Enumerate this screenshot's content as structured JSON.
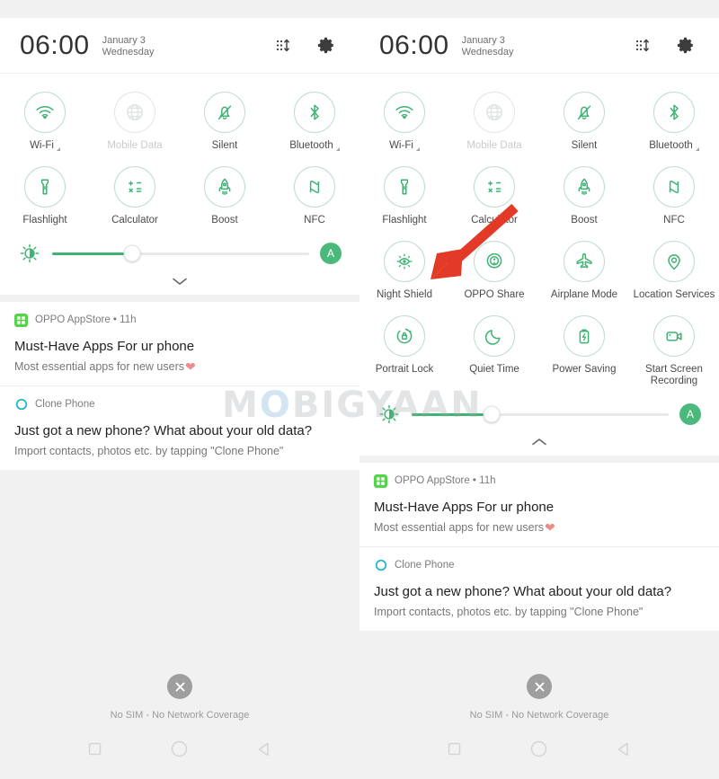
{
  "status": {
    "time": "06:00",
    "date": "January 3",
    "weekday": "Wednesday",
    "header_icons": {
      "edit_tiles": "edit-tiles-icon",
      "settings": "gear-icon"
    }
  },
  "brightness": {
    "sun_icon": "brightness-icon",
    "level_percent": 31,
    "auto_label": "A",
    "expand_icon": "chevron-down-icon",
    "collapse_icon": "chevron-up-icon"
  },
  "colors": {
    "accent_green": "#4cb97c",
    "tile_outline": "#bfdcce",
    "tile_outline_off": "#e2e6e3",
    "panel_bg": "#ffffff",
    "page_bg": "#f1f1f1",
    "arrow_red": "#e23a26",
    "label": "#4a4a4a",
    "label_off": "#c9cdca"
  },
  "tiles_collapsed": [
    {
      "label": "Wi-Fi",
      "icon": "wifi-icon",
      "enabled": true,
      "has_expand_arrow": true
    },
    {
      "label": "Mobile Data",
      "icon": "globe-icon",
      "enabled": false,
      "has_expand_arrow": false
    },
    {
      "label": "Silent",
      "icon": "bell-muted-icon",
      "enabled": true,
      "has_expand_arrow": false
    },
    {
      "label": "Bluetooth",
      "icon": "bluetooth-icon",
      "enabled": true,
      "has_expand_arrow": true
    },
    {
      "label": "Flashlight",
      "icon": "flashlight-icon",
      "enabled": true,
      "has_expand_arrow": false
    },
    {
      "label": "Calculator",
      "icon": "calculator-icon",
      "enabled": true,
      "has_expand_arrow": false
    },
    {
      "label": "Boost",
      "icon": "rocket-icon",
      "enabled": true,
      "has_expand_arrow": false
    },
    {
      "label": "NFC",
      "icon": "nfc-icon",
      "enabled": true,
      "has_expand_arrow": false
    }
  ],
  "tiles_expanded": [
    {
      "label": "Wi-Fi",
      "icon": "wifi-icon",
      "enabled": true,
      "has_expand_arrow": true
    },
    {
      "label": "Mobile Data",
      "icon": "globe-icon",
      "enabled": false,
      "has_expand_arrow": false
    },
    {
      "label": "Silent",
      "icon": "bell-muted-icon",
      "enabled": true,
      "has_expand_arrow": false
    },
    {
      "label": "Bluetooth",
      "icon": "bluetooth-icon",
      "enabled": true,
      "has_expand_arrow": true
    },
    {
      "label": "Flashlight",
      "icon": "flashlight-icon",
      "enabled": true,
      "has_expand_arrow": false
    },
    {
      "label": "Calculator",
      "icon": "calculator-icon",
      "enabled": true,
      "has_expand_arrow": false
    },
    {
      "label": "Boost",
      "icon": "rocket-icon",
      "enabled": true,
      "has_expand_arrow": false
    },
    {
      "label": "NFC",
      "icon": "nfc-icon",
      "enabled": true,
      "has_expand_arrow": false
    },
    {
      "label": "Night Shield",
      "icon": "night-shield-icon",
      "enabled": true,
      "has_expand_arrow": false
    },
    {
      "label": "OPPO Share",
      "icon": "oppo-share-icon",
      "enabled": true,
      "has_expand_arrow": false
    },
    {
      "label": "Airplane Mode",
      "icon": "airplane-icon",
      "enabled": true,
      "has_expand_arrow": false
    },
    {
      "label": "Location Services",
      "icon": "location-pin-icon",
      "enabled": true,
      "has_expand_arrow": false
    },
    {
      "label": "Portrait Lock",
      "icon": "rotation-lock-icon",
      "enabled": true,
      "has_expand_arrow": false
    },
    {
      "label": "Quiet Time",
      "icon": "moon-icon",
      "enabled": true,
      "has_expand_arrow": false
    },
    {
      "label": "Power Saving",
      "icon": "battery-saver-icon",
      "enabled": true,
      "has_expand_arrow": false
    },
    {
      "label": "Start Screen Recording",
      "icon": "screen-record-icon",
      "enabled": true,
      "has_expand_arrow": false
    }
  ],
  "notifications": [
    {
      "app": "OPPO AppStore",
      "time": "11h",
      "separator": "•",
      "app_icon": "oppo-appstore-icon",
      "title": "Must-Have Apps For ur phone",
      "body": "Most essential apps for new users",
      "body_emoji": "❤"
    },
    {
      "app": "Clone Phone",
      "time": "",
      "separator": "",
      "app_icon": "clone-phone-icon",
      "title": "Just got a new phone? What about your old data?",
      "body": "Import contacts, photos etc. by tapping \"Clone Phone\"",
      "body_emoji": ""
    }
  ],
  "bottom": {
    "dismiss_icon": "close-circle-icon",
    "sim_status": "No SIM - No Network Coverage",
    "nav": {
      "recents": "recents-square-icon",
      "home": "home-circle-icon",
      "back": "back-triangle-icon"
    }
  },
  "watermark": {
    "part1": "M",
    "part2": "O",
    "part3": "BIGYAAN"
  },
  "annotation": {
    "arrow": "red-pointer-arrow",
    "points_at": "Night Shield"
  }
}
